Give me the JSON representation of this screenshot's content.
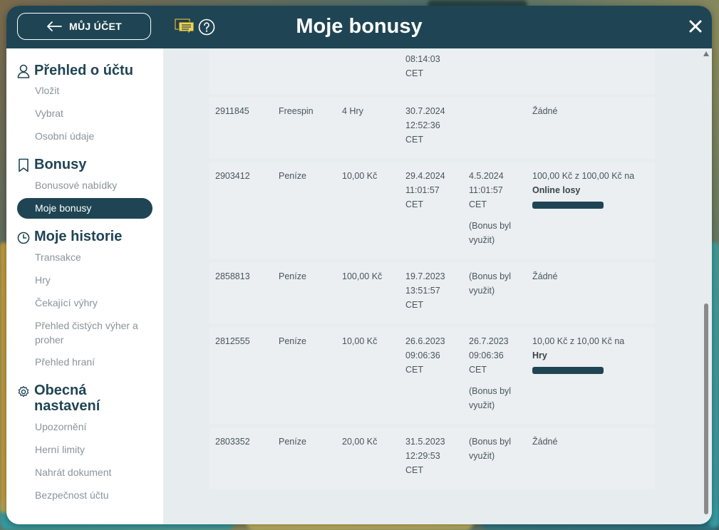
{
  "header": {
    "back_label": "MŮJ ÚČET",
    "title": "Moje bonusy"
  },
  "sidebar": {
    "sections": [
      {
        "title": "Přehled o účtu",
        "icon": "user-icon",
        "items": [
          "Vložit",
          "Vybrat",
          "Osobní údaje"
        ]
      },
      {
        "title": "Bonusy",
        "icon": "bookmark-icon",
        "items": [
          "Bonusové nabídky",
          "Moje bonusy"
        ]
      },
      {
        "title": "Moje historie",
        "icon": "clock-icon",
        "items": [
          "Transakce",
          "Hry",
          "Čekající výhry",
          "Přehled čistých výher a proher",
          "Přehled hraní"
        ]
      },
      {
        "title": "Obecná nastavení",
        "icon": "gear-icon",
        "items": [
          "Upozornění",
          "Herní limity",
          "Nahrát dokument",
          "Bezpečnost účtu"
        ]
      }
    ],
    "active_item": "Moje bonusy"
  },
  "bonuses": {
    "partial_row": {
      "from_time": "08:14:03",
      "from_tz": "CET"
    },
    "rows": [
      {
        "id": "2911845",
        "type": "Freespin",
        "amount": "4 Hry",
        "from_date": "30.7.2024",
        "from_time": "12:52:36",
        "from_tz": "CET",
        "to_date": "",
        "to_time": "",
        "to_tz": "",
        "to_note": "",
        "condition": "Žádné",
        "cond_game": "",
        "progress": null
      },
      {
        "id": "2903412",
        "type": "Peníze",
        "amount": "10,00 Kč",
        "from_date": "29.4.2024",
        "from_time": "11:01:57",
        "from_tz": "CET",
        "to_date": "4.5.2024",
        "to_time": "11:01:57",
        "to_tz": "CET",
        "to_note": "(Bonus byl využit)",
        "condition": "100,00 Kč z 100,00 Kč na",
        "cond_game": "Online losy",
        "progress": 1.0
      },
      {
        "id": "2858813",
        "type": "Peníze",
        "amount": "100,00 Kč",
        "from_date": "19.7.2023",
        "from_time": "13:51:57",
        "from_tz": "CET",
        "to_date": "",
        "to_time": "",
        "to_tz": "",
        "to_note": "(Bonus byl využit)",
        "condition": "Žádné",
        "cond_game": "",
        "progress": null
      },
      {
        "id": "2812555",
        "type": "Peníze",
        "amount": "10,00 Kč",
        "from_date": "26.6.2023",
        "from_time": "09:06:36",
        "from_tz": "CET",
        "to_date": "26.7.2023",
        "to_time": "09:06:36",
        "to_tz": "CET",
        "to_note": "(Bonus byl využit)",
        "condition": "10,00 Kč z 10,00 Kč na",
        "cond_game": "Hry",
        "progress": 1.0
      },
      {
        "id": "2803352",
        "type": "Peníze",
        "amount": "20,00 Kč",
        "from_date": "31.5.2023",
        "from_time": "12:29:53",
        "from_tz": "CET",
        "to_date": "",
        "to_time": "",
        "to_tz": "",
        "to_note": "(Bonus byl využit)",
        "condition": "Žádné",
        "cond_game": "",
        "progress": null
      }
    ]
  },
  "colors": {
    "header_bg": "#1f4554",
    "accent": "#1f4554",
    "muted_text": "#8b9398",
    "content_bg": "#e7edef"
  }
}
